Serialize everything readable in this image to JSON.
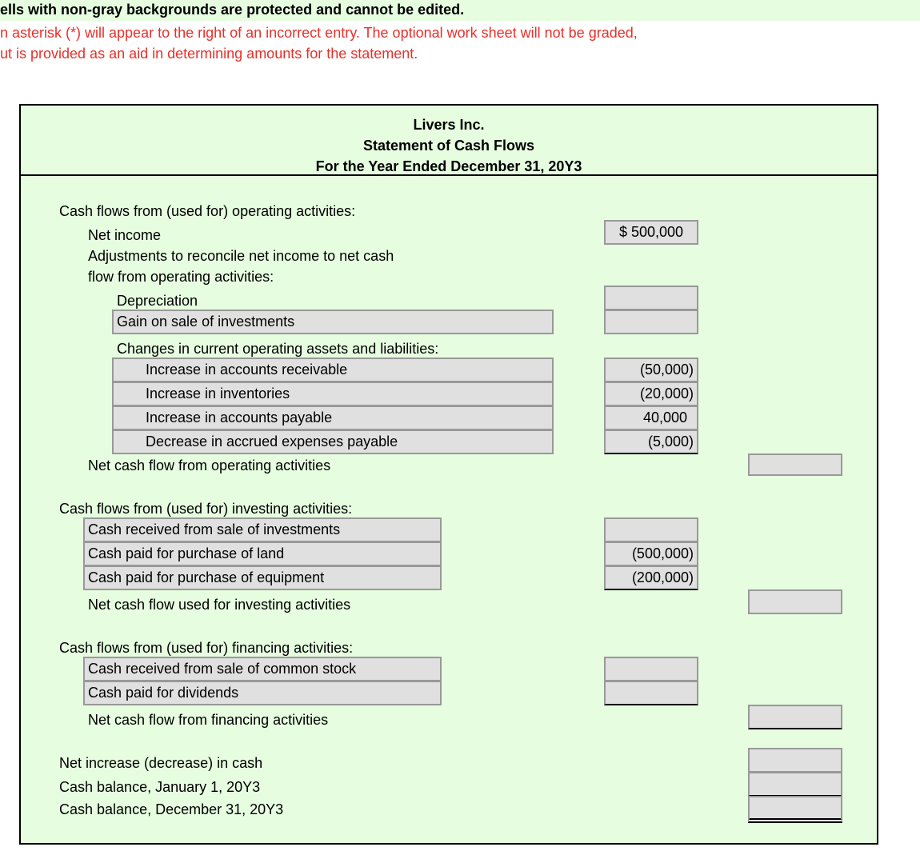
{
  "notices": {
    "protected": "ells with non-gray backgrounds are protected and cannot be edited.",
    "asterisk_line1": "n asterisk (*) will appear to the right of an incorrect entry.  The optional work sheet will not be graded,",
    "asterisk_line2": "ut is provided as an aid in determining amounts for the statement."
  },
  "header": {
    "company": "Livers Inc.",
    "title": "Statement of Cash Flows",
    "period": "For the Year Ended December 31, 20Y3"
  },
  "operating": {
    "heading": "Cash flows from (used for) operating activities:",
    "net_income_label": "Net income",
    "net_income_value": "$ 500,000",
    "adjustments_line1": "Adjustments to reconcile net income to net cash",
    "adjustments_line2": "flow from operating activities:",
    "depreciation_label": "Depreciation",
    "depreciation_value": "",
    "gain_label": "Gain on sale of investments",
    "gain_value": "",
    "changes_heading": "Changes in current operating assets and liabilities:",
    "changes": [
      {
        "label": "Increase in accounts receivable",
        "value": "(50,000)"
      },
      {
        "label": "Increase in inventories",
        "value": "(20,000)"
      },
      {
        "label": "Increase in accounts payable",
        "value": "40,000"
      },
      {
        "label": "Decrease in accrued expenses payable",
        "value": "(5,000)"
      }
    ],
    "net_label": "Net cash flow from operating activities",
    "net_value": ""
  },
  "investing": {
    "heading": "Cash flows from (used for) investing activities:",
    "items": [
      {
        "label": "Cash received from sale of investments",
        "value": ""
      },
      {
        "label": "Cash paid for purchase of land",
        "value": "(500,000)"
      },
      {
        "label": "Cash paid for purchase of equipment",
        "value": "(200,000)"
      }
    ],
    "net_label": "Net cash flow used for investing activities",
    "net_value": ""
  },
  "financing": {
    "heading": "Cash flows from (used for) financing activities:",
    "items": [
      {
        "label": "Cash received from sale of common stock",
        "value": ""
      },
      {
        "label": "Cash paid for dividends",
        "value": ""
      }
    ],
    "net_label": "Net cash flow from financing activities",
    "net_value": ""
  },
  "summary": {
    "net_change_label": "Net increase (decrease) in cash",
    "net_change_value": "",
    "beginning_label": "Cash balance, January 1, 20Y3",
    "beginning_value": "",
    "ending_label": "Cash balance, December 31, 20Y3",
    "ending_value": ""
  }
}
